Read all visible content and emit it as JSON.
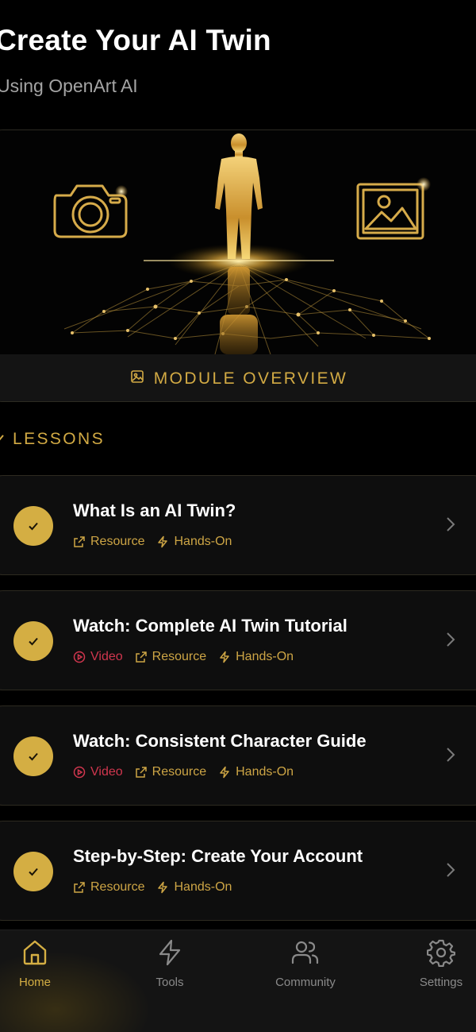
{
  "header": {
    "title": "Create Your AI Twin",
    "subtitle": "Using OpenArt AI"
  },
  "hero": {
    "button_label": "MODULE OVERVIEW",
    "button_icon": "image-icon"
  },
  "lessons_section": {
    "label": "LESSONS",
    "icon": "chevron-down-icon"
  },
  "lessons": [
    {
      "title": "What Is an AI Twin?",
      "completed": true,
      "tags": {
        "resource": "Resource",
        "hands_on": "Hands-On"
      }
    },
    {
      "title": "Watch: Complete AI Twin Tutorial",
      "completed": true,
      "tags": {
        "video": "Video",
        "resource": "Resource",
        "hands_on": "Hands-On"
      }
    },
    {
      "title": "Watch: Consistent Character Guide",
      "completed": true,
      "tags": {
        "video": "Video",
        "resource": "Resource",
        "hands_on": "Hands-On"
      }
    },
    {
      "title": "Step-by-Step: Create Your Account",
      "completed": true,
      "tags": {
        "resource": "Resource",
        "hands_on": "Hands-On"
      }
    }
  ],
  "nav": {
    "active": "Home",
    "items": [
      {
        "label": "Home",
        "icon": "home-icon"
      },
      {
        "label": "Tools",
        "icon": "lightning-icon"
      },
      {
        "label": "Community",
        "icon": "users-icon"
      },
      {
        "label": "Settings",
        "icon": "gear-icon"
      }
    ]
  },
  "colors": {
    "accent_gold": "#d4ae43",
    "video_red": "#d0364e",
    "background": "#000000",
    "card": "#0e0e0e"
  }
}
